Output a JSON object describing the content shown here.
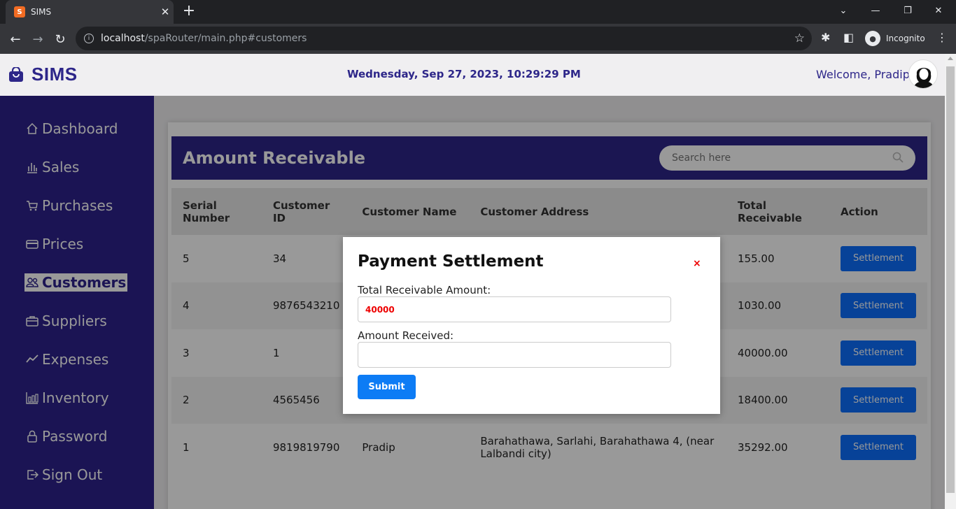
{
  "browser": {
    "tab_title": "SIMS",
    "favicon_text": "S",
    "url_host": "localhost",
    "url_path": "/spaRouter/main.php#customers",
    "incognito_label": "Incognito"
  },
  "header": {
    "logo": "SIMS",
    "datetime": "Wednesday, Sep 27, 2023, 10:29:29 PM",
    "welcome": "Welcome, Pradip"
  },
  "sidebar": {
    "items": [
      {
        "label": "Dashboard",
        "icon": "home-icon"
      },
      {
        "label": "Sales",
        "icon": "bar-chart-icon"
      },
      {
        "label": "Purchases",
        "icon": "cart-icon"
      },
      {
        "label": "Prices",
        "icon": "credit-card-icon"
      },
      {
        "label": "Customers",
        "icon": "people-icon",
        "active": true
      },
      {
        "label": "Suppliers",
        "icon": "briefcase-icon"
      },
      {
        "label": "Expenses",
        "icon": "trend-icon"
      },
      {
        "label": "Inventory",
        "icon": "columns-icon"
      },
      {
        "label": "Password",
        "icon": "lock-icon"
      },
      {
        "label": "Sign Out",
        "icon": "sign-out-icon"
      }
    ]
  },
  "panel": {
    "title": "Amount Receivable",
    "search_placeholder": "Search here",
    "columns": [
      "Serial Number",
      "Customer ID",
      "Customer Name",
      "Customer Address",
      "Total Receivable",
      "Action"
    ],
    "rows": [
      {
        "serial": "5",
        "customer_id": "34",
        "name": "",
        "address": "",
        "total": "155.00",
        "action": "Settlement"
      },
      {
        "serial": "4",
        "customer_id": "9876543210",
        "name": "",
        "address": "",
        "total": "1030.00",
        "action": "Settlement"
      },
      {
        "serial": "3",
        "customer_id": "1",
        "name": "",
        "address": "",
        "total": "40000.00",
        "action": "Settlement"
      },
      {
        "serial": "2",
        "customer_id": "4565456",
        "name": "",
        "address": "",
        "total": "18400.00",
        "action": "Settlement"
      },
      {
        "serial": "1",
        "customer_id": "9819819790",
        "name": "Pradip",
        "address": "Barahathawa, Sarlahi, Barahathawa 4, (near Lalbandi city)",
        "total": "35292.00",
        "action": "Settlement"
      }
    ]
  },
  "modal": {
    "title": "Payment Settlement",
    "close": "×",
    "total_label": "Total Receivable Amount:",
    "total_value": "40000",
    "received_label": "Amount Received:",
    "received_value": "",
    "submit": "Submit"
  },
  "colors": {
    "brand": "#2d2689",
    "sidebar": "#2d228c",
    "button": "#0d6efd",
    "accent_red": "#ee0000"
  }
}
